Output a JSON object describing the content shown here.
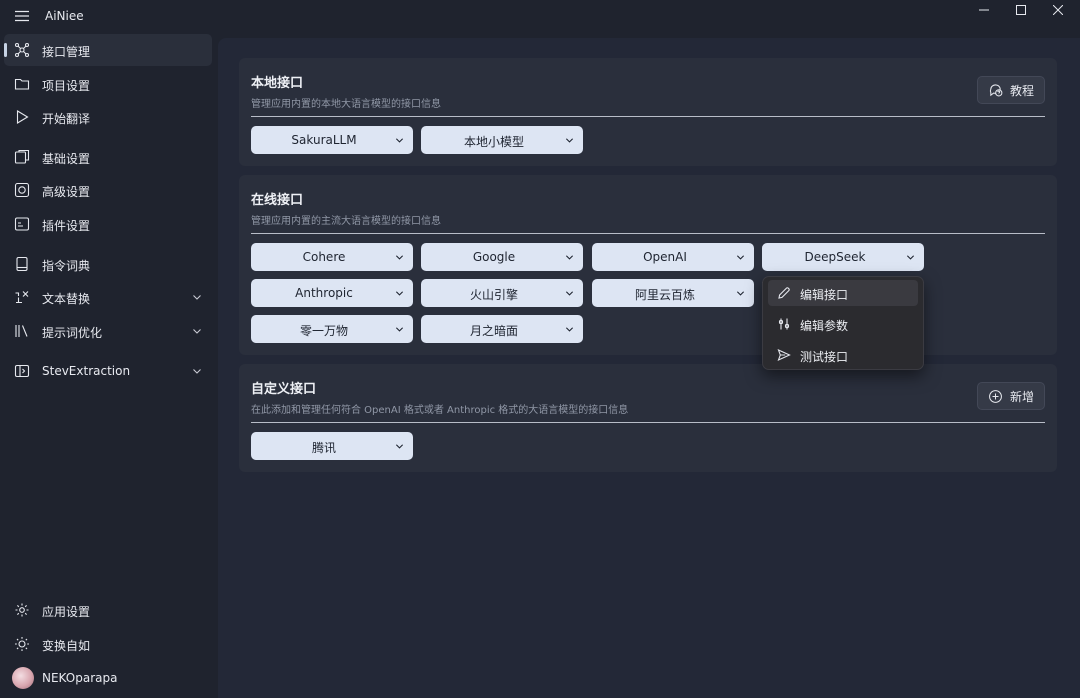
{
  "app": {
    "title": "AiNiee"
  },
  "sidebar": {
    "items": [
      {
        "label": "接口管理",
        "icon": "api-nodes-icon",
        "active": true
      },
      {
        "label": "项目设置",
        "icon": "folder-icon"
      },
      {
        "label": "开始翻译",
        "icon": "play-icon"
      },
      {
        "label": "基础设置",
        "icon": "basic-settings-icon"
      },
      {
        "label": "高级设置",
        "icon": "advanced-settings-icon"
      },
      {
        "label": "插件设置",
        "icon": "plugin-icon"
      },
      {
        "label": "指令词典",
        "icon": "dictionary-icon",
        "expandable": false
      },
      {
        "label": "文本替换",
        "icon": "text-replace-icon",
        "expandable": true
      },
      {
        "label": "提示词优化",
        "icon": "prompt-icon",
        "expandable": true
      },
      {
        "label": "StevExtraction",
        "icon": "extraction-icon",
        "expandable": true
      }
    ],
    "footer": [
      {
        "label": "应用设置",
        "icon": "gear-icon"
      },
      {
        "label": "变换自如",
        "icon": "brightness-icon"
      },
      {
        "label": "NEKOparapa",
        "icon": "avatar"
      }
    ]
  },
  "local": {
    "title": "本地接口",
    "subtitle": "管理应用内置的本地大语言模型的接口信息",
    "action_label": "教程",
    "items": [
      "SakuraLLM",
      "本地小模型"
    ]
  },
  "online": {
    "title": "在线接口",
    "subtitle": "管理应用内置的主流大语言模型的接口信息",
    "items": [
      "Cohere",
      "Google",
      "OpenAI",
      "DeepSeek",
      "Anthropic",
      "火山引擎",
      "阿里云百炼",
      "",
      "零一万物",
      "月之暗面"
    ]
  },
  "custom": {
    "title": "自定义接口",
    "subtitle": "在此添加和管理任何符合 OpenAI 格式或者 Anthropic 格式的大语言模型的接口信息",
    "action_label": "新增",
    "items": [
      "腾讯"
    ]
  },
  "context_menu": {
    "items": [
      {
        "label": "编辑接口",
        "icon": "pencil-icon"
      },
      {
        "label": "编辑参数",
        "icon": "sliders-icon"
      },
      {
        "label": "测试接口",
        "icon": "send-icon"
      }
    ]
  },
  "colors": {
    "background": "#1f232e",
    "content": "#232837",
    "card": "#2a2f3c",
    "pill": "#dde5f3",
    "menu": "#2b2b2f"
  }
}
